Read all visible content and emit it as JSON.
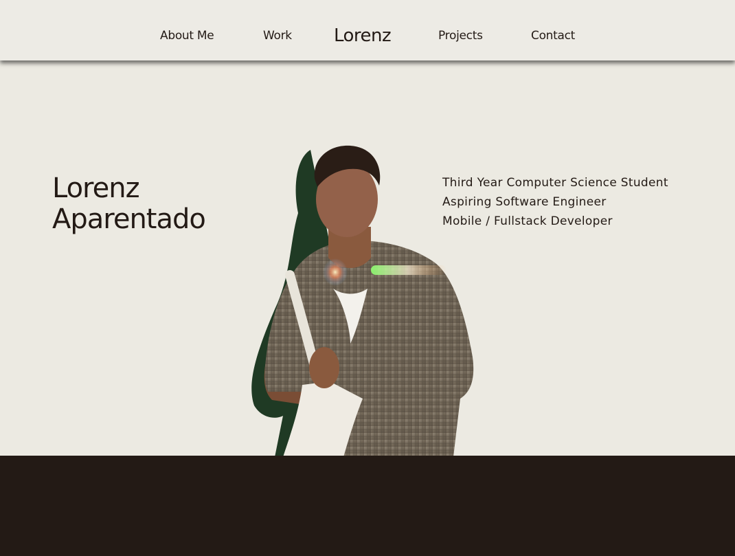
{
  "nav": {
    "about_label": "About Me",
    "work_label": "Work",
    "brand": "Lorenz",
    "projects_label": "Projects",
    "contact_label": "Contact"
  },
  "hero": {
    "first_name": "Lorenz",
    "last_name": "Aparentado",
    "taglines": [
      "Third Year Computer Science Student",
      "Aspiring Software Engineer",
      "Mobile / Fullstack Developer"
    ]
  },
  "colors": {
    "background": "#ECEAE2",
    "text": "#231A15",
    "dark_band": "#231A15",
    "shadow_green": "#1F3A24"
  }
}
